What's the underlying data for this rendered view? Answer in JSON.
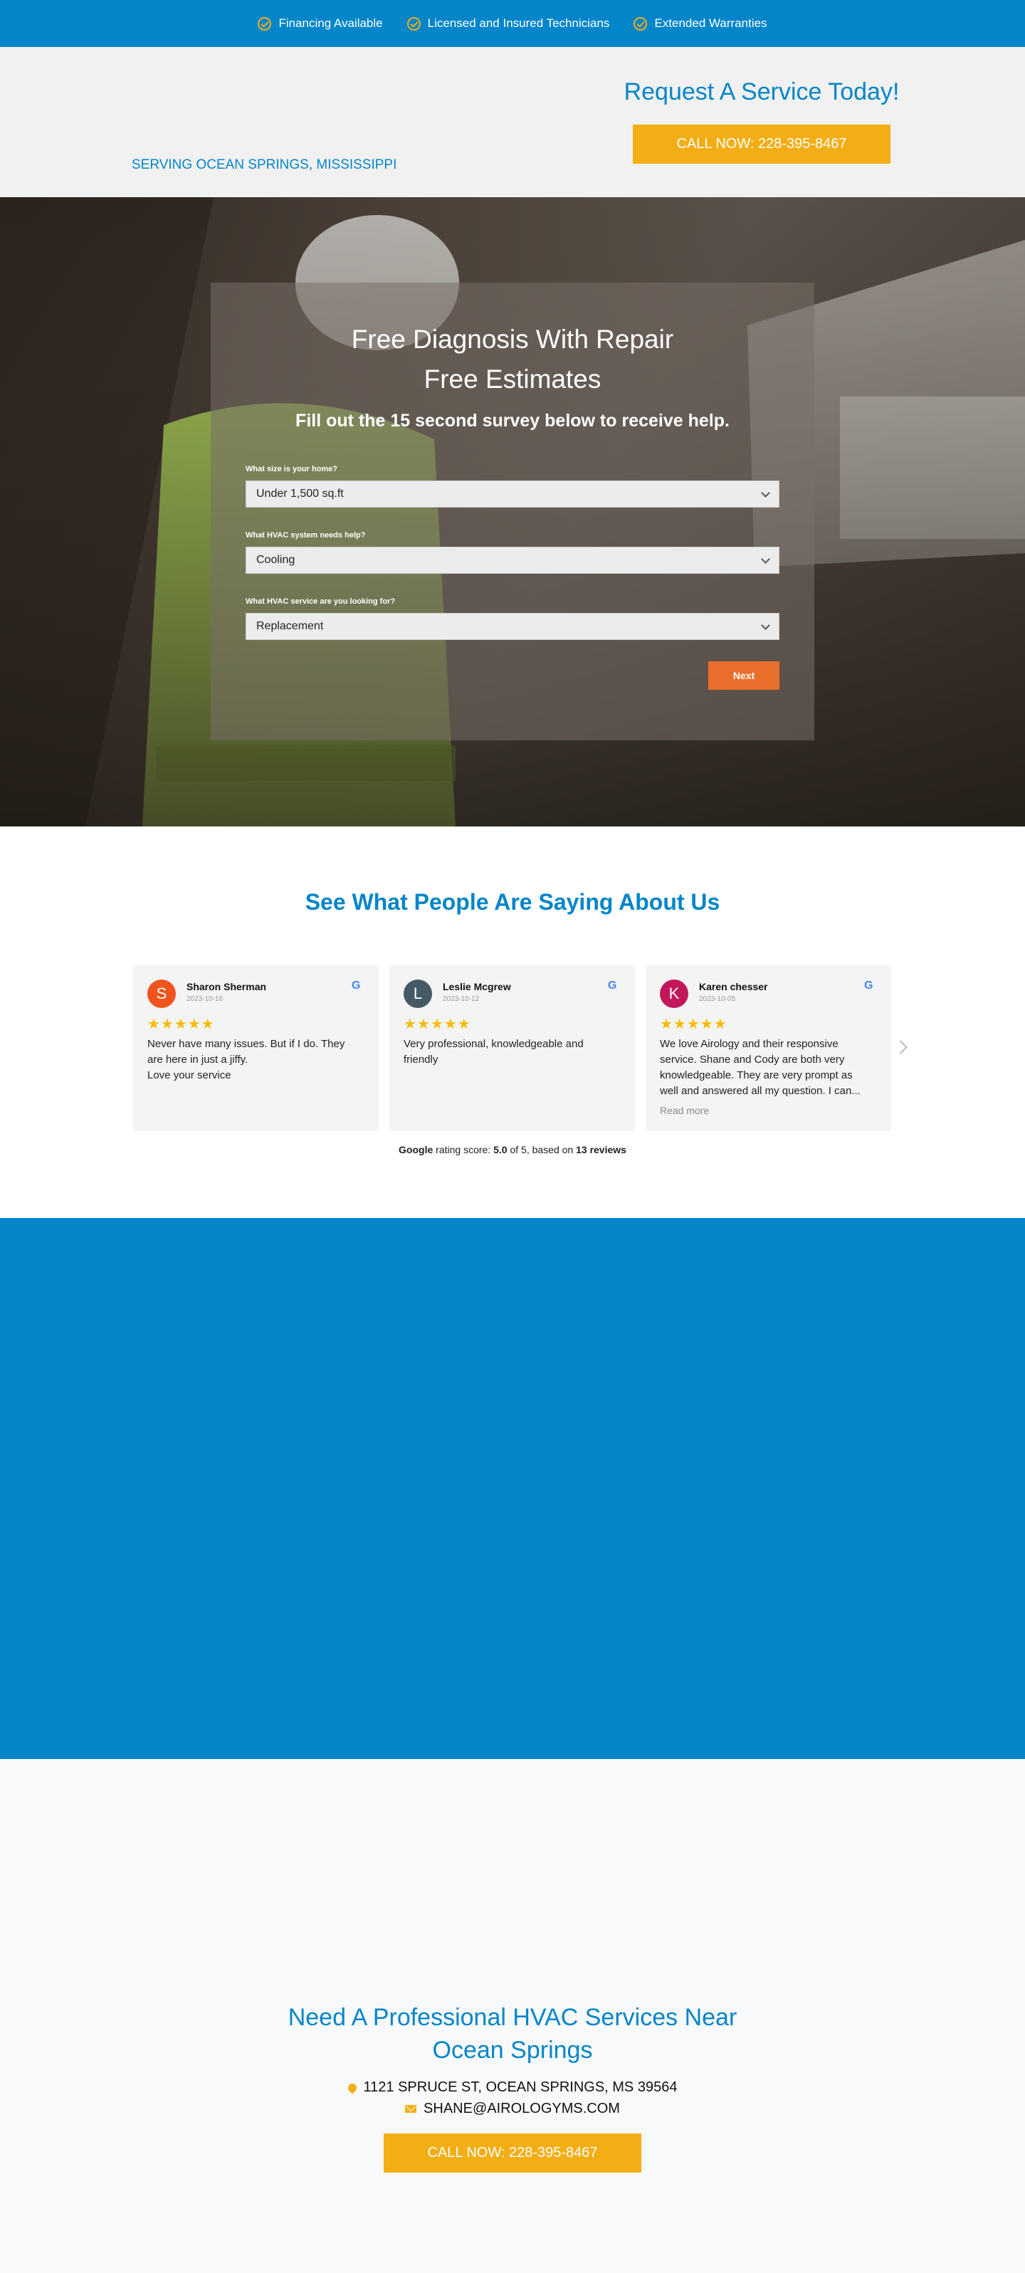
{
  "topbar": {
    "items": [
      "Financing Available",
      "Licensed and Insured Technicians",
      "Extended Warranties"
    ]
  },
  "header": {
    "serving": "SERVING OCEAN SPRINGS, MISSISSIPPI",
    "request_title": "Request A Service Today!",
    "call_label": "CALL NOW: 228-395-8467"
  },
  "hero": {
    "title_line1": "Free Diagnosis With Repair",
    "title_line2": "Free Estimates",
    "subtitle": "Fill out the 15 second survey below to receive help.",
    "fields": [
      {
        "label": "What size is your home?",
        "value": "Under 1,500 sq.ft"
      },
      {
        "label": "What HVAC system needs help?",
        "value": "Cooling"
      },
      {
        "label": "What HVAC service are you looking for?",
        "value": "Replacement"
      }
    ],
    "next_label": "Next"
  },
  "reviews": {
    "title": "See What People Are Saying About Us",
    "cards": [
      {
        "initial": "S",
        "name": "Sharon Sherman",
        "date": "2023-10-16",
        "stars": "★★★★★",
        "text": "Never have many issues. But if I do. They are here in just a jiffy.\nLove your service",
        "color": "#f0541e"
      },
      {
        "initial": "L",
        "name": "Leslie Mcgrew",
        "date": "2023-10-12",
        "stars": "★★★★★",
        "text": "Very professional, knowledgeable and friendly",
        "color": "#455a64"
      },
      {
        "initial": "K",
        "name": "Karen chesser",
        "date": "2023-10-05",
        "stars": "★★★★★",
        "text": "We love Airology and their responsive service. Shane and Cody are both very knowledgeable. They are very prompt as well and answered all my question. I can...",
        "color": "#c2185b",
        "read_more": "Read more"
      }
    ],
    "rating": {
      "source": "Google",
      "mid": " rating score: ",
      "score": "5.0",
      "of": " of 5, based on ",
      "count": "13 reviews"
    }
  },
  "cta": {
    "title": "Need A Professional HVAC Services Near Ocean Springs",
    "address": "1121 SPRUCE ST, OCEAN SPRINGS, MS 39564",
    "email": "SHANE@AIROLOGYMS.COM",
    "call_label": "CALL NOW: 228-395-8467"
  },
  "colors": {
    "brand_blue": "#0385c9",
    "accent_yellow": "#f3ae16",
    "next_orange": "#ea6e2b"
  }
}
